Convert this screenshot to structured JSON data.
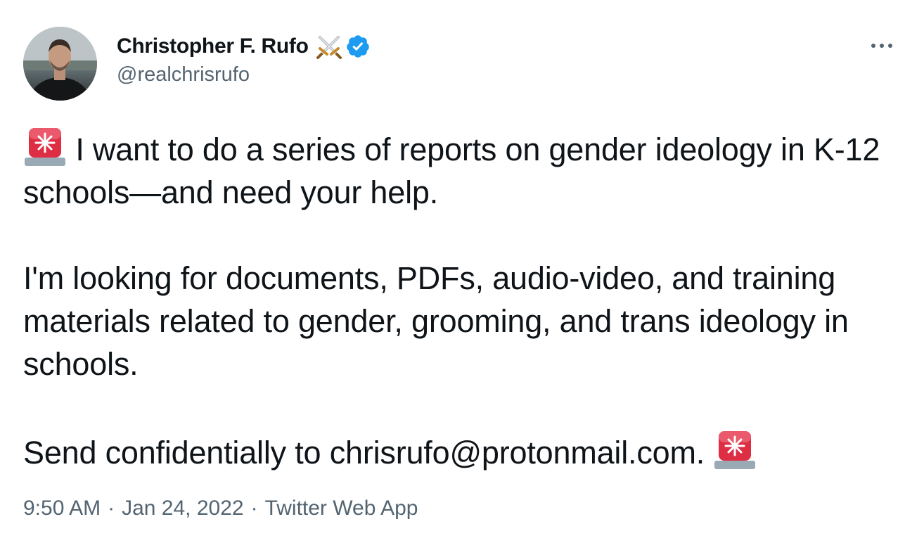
{
  "author": {
    "display_name": "Christopher F. Rufo",
    "handle": "@realchrisrufo",
    "badge_emoji_icon": "crossed-swords-icon",
    "verified_icon": "verified-badge-icon",
    "verified_color": "#1d9bf0"
  },
  "tweet": {
    "paragraph1": "I want to do a series of reports on gender ideology in K-12 schools—and need your help.",
    "paragraph2": "I'm looking for documents, PDFs, audio-video, and training materials related to gender, grooming, and trans ideology in schools.",
    "paragraph3": "Send confidentially to chrisrufo@protonmail.com.",
    "emoji_icon": "rotating-light-icon"
  },
  "meta": {
    "time": "9:50 AM",
    "separator": "·",
    "date": "Jan 24, 2022",
    "source": "Twitter Web App"
  },
  "colors": {
    "text": "#0f1419",
    "secondary": "#536471",
    "siren": "#dd2e44"
  }
}
